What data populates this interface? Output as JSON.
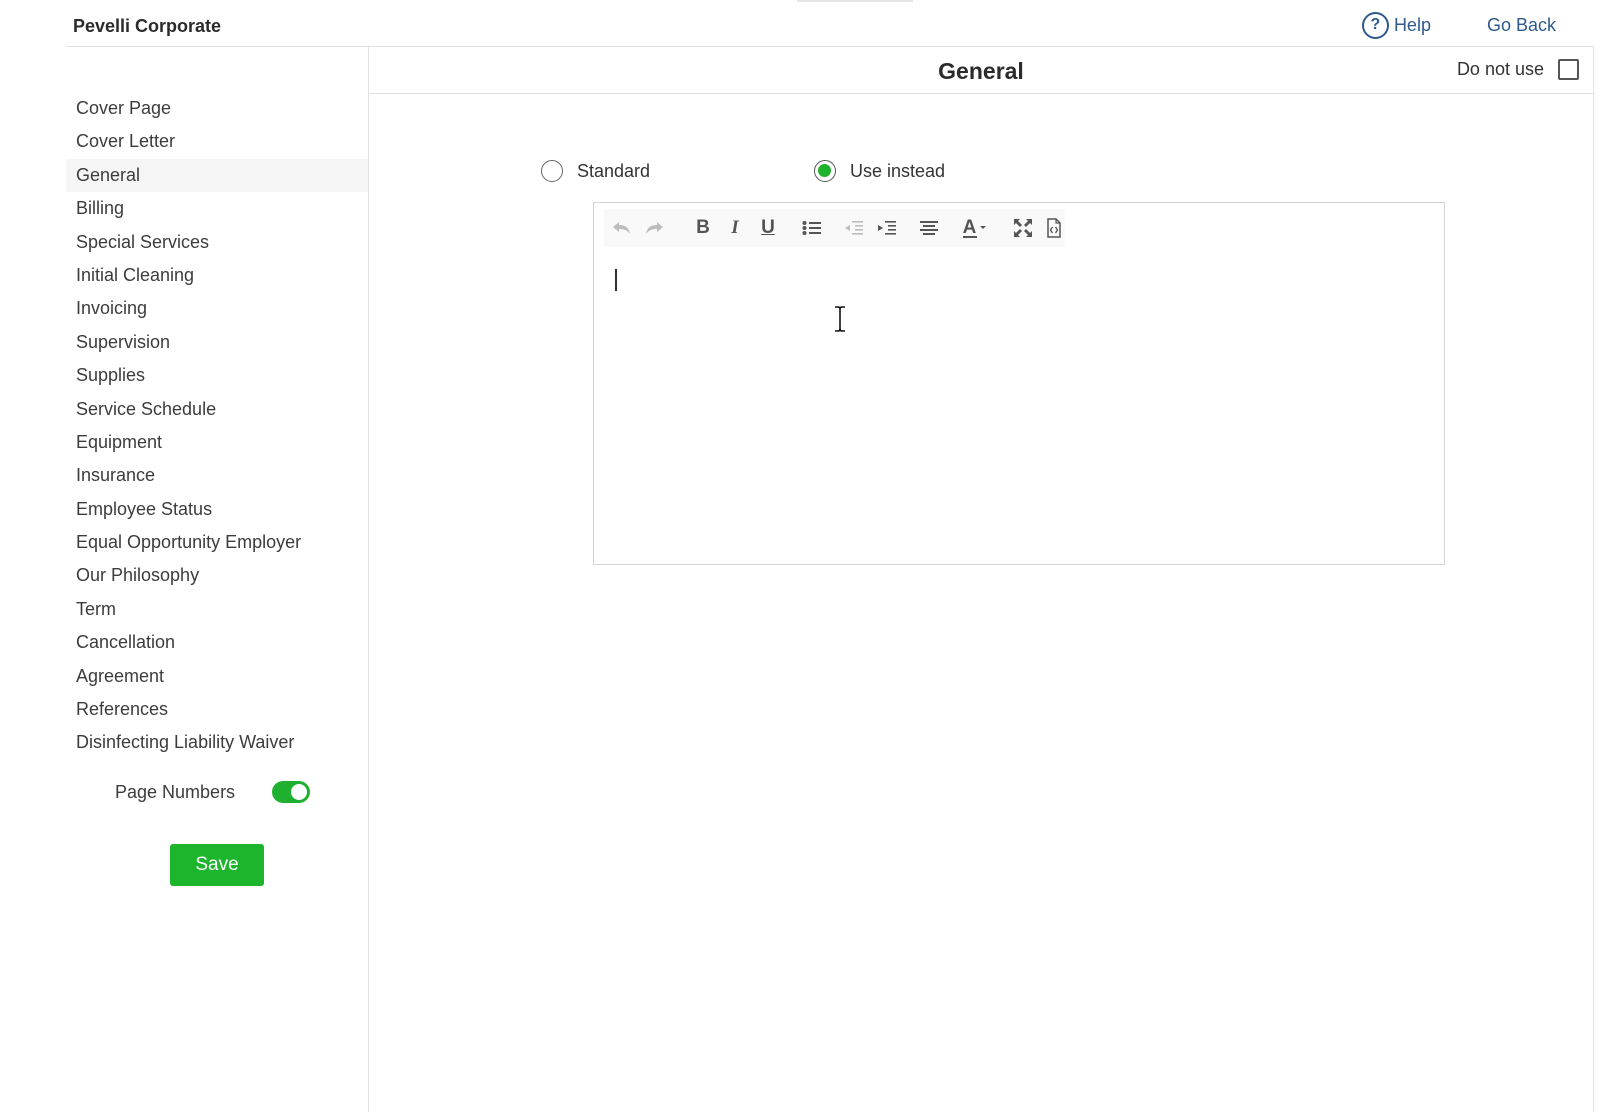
{
  "app": {
    "company_name": "Pevelli Corporate"
  },
  "topbar": {
    "help_label": "Help",
    "go_back_label": "Go Back"
  },
  "sidebar": {
    "items": [
      {
        "label": "Cover Page"
      },
      {
        "label": "Cover Letter"
      },
      {
        "label": "General",
        "active": true
      },
      {
        "label": "Billing"
      },
      {
        "label": "Special Services"
      },
      {
        "label": "Initial Cleaning"
      },
      {
        "label": "Invoicing"
      },
      {
        "label": "Supervision"
      },
      {
        "label": "Supplies"
      },
      {
        "label": "Service Schedule"
      },
      {
        "label": "Equipment"
      },
      {
        "label": "Insurance"
      },
      {
        "label": "Employee Status"
      },
      {
        "label": "Equal Opportunity Employer"
      },
      {
        "label": "Our Philosophy"
      },
      {
        "label": "Term"
      },
      {
        "label": "Cancellation"
      },
      {
        "label": "Agreement"
      },
      {
        "label": "References"
      },
      {
        "label": "Disinfecting Liability Waiver"
      }
    ],
    "page_numbers_label": "Page Numbers",
    "page_numbers_enabled": true,
    "save_label": "Save"
  },
  "main": {
    "title": "General",
    "do_not_use_label": "Do not use",
    "do_not_use_checked": false,
    "options": {
      "standard_label": "Standard",
      "use_instead_label": "Use instead",
      "selected": "use_instead"
    },
    "editor": {
      "content": "",
      "toolbar_icons": [
        "undo-icon",
        "redo-icon",
        "bold-icon",
        "italic-icon",
        "underline-icon",
        "bulleted-list-icon",
        "outdent-icon",
        "indent-icon",
        "align-center-icon",
        "font-color-icon",
        "fullscreen-icon",
        "source-code-icon"
      ],
      "bold_glyph": "B",
      "italic_glyph": "I",
      "underline_glyph": "U",
      "font_color_glyph": "A"
    }
  },
  "colors": {
    "accent_green": "#1db52b",
    "link_blue": "#2e5a8c",
    "text_dark": "#333333",
    "border": "#e2e2e2"
  }
}
